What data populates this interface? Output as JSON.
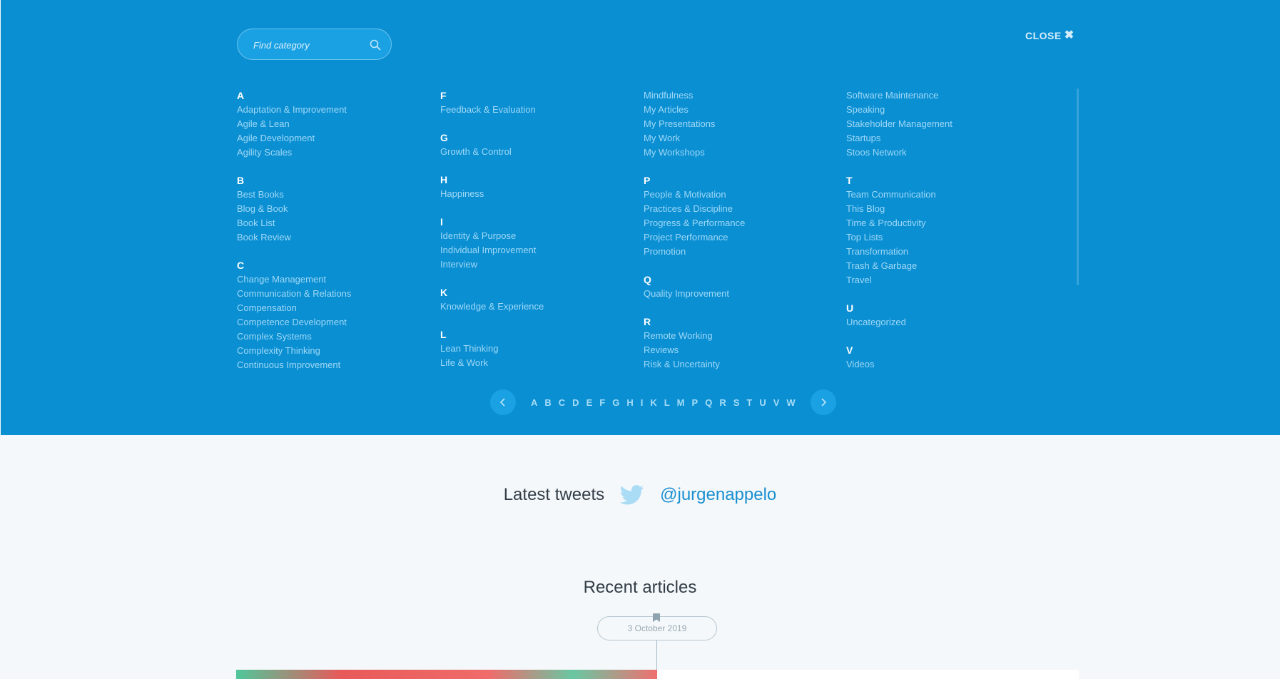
{
  "overlay": {
    "search_placeholder": "Find category",
    "close_label": "CLOSE",
    "columns": [
      [
        {
          "letter": "A",
          "items": [
            "Adaptation & Improvement",
            "Agile & Lean",
            "Agile Development",
            "Agility Scales"
          ]
        },
        {
          "letter": "B",
          "items": [
            "Best Books",
            "Blog & Book",
            "Book List",
            "Book Review"
          ]
        },
        {
          "letter": "C",
          "items": [
            "Change Management",
            "Communication & Relations",
            "Compensation",
            "Competence Development",
            "Complex Systems",
            "Complexity Thinking",
            "Continuous Improvement"
          ]
        }
      ],
      [
        {
          "letter": "F",
          "items": [
            "Feedback & Evaluation"
          ]
        },
        {
          "letter": "G",
          "items": [
            "Growth & Control"
          ]
        },
        {
          "letter": "H",
          "items": [
            "Happiness"
          ]
        },
        {
          "letter": "I",
          "items": [
            "Identity & Purpose",
            "Individual Improvement",
            "Interview"
          ]
        },
        {
          "letter": "K",
          "items": [
            "Knowledge & Experience"
          ]
        },
        {
          "letter": "L",
          "items": [
            "Lean Thinking",
            "Life & Work"
          ]
        }
      ],
      [
        {
          "letter": "",
          "items": [
            "Mindfulness",
            "My Articles",
            "My Presentations",
            "My Work",
            "My Workshops"
          ]
        },
        {
          "letter": "P",
          "items": [
            "People & Motivation",
            "Practices & Discipline",
            "Progress & Performance",
            "Project Performance",
            "Promotion"
          ]
        },
        {
          "letter": "Q",
          "items": [
            "Quality Improvement"
          ]
        },
        {
          "letter": "R",
          "items": [
            "Remote Working",
            "Reviews",
            "Risk & Uncertainty"
          ]
        }
      ],
      [
        {
          "letter": "",
          "items": [
            "Software Maintenance",
            "Speaking",
            "Stakeholder Management",
            "Startups",
            "Stoos Network"
          ]
        },
        {
          "letter": "T",
          "items": [
            "Team Communication",
            "This Blog",
            "Time & Productivity",
            "Top Lists",
            "Transformation",
            "Trash & Garbage",
            "Travel"
          ]
        },
        {
          "letter": "U",
          "items": [
            "Uncategorized"
          ]
        },
        {
          "letter": "V",
          "items": [
            "Videos"
          ]
        }
      ]
    ],
    "alphabet": [
      "A",
      "B",
      "C",
      "D",
      "E",
      "F",
      "G",
      "H",
      "I",
      "K",
      "L",
      "M",
      "P",
      "Q",
      "R",
      "S",
      "T",
      "U",
      "V",
      "W"
    ]
  },
  "tweets": {
    "title": "Latest tweets",
    "handle": "@jurgenappelo"
  },
  "articles": {
    "title": "Recent articles",
    "date": "3 October 2019"
  },
  "colors": {
    "overlay": "#0a8fd3",
    "link": "#9fd8f5",
    "accent": "#1a8fd0"
  }
}
